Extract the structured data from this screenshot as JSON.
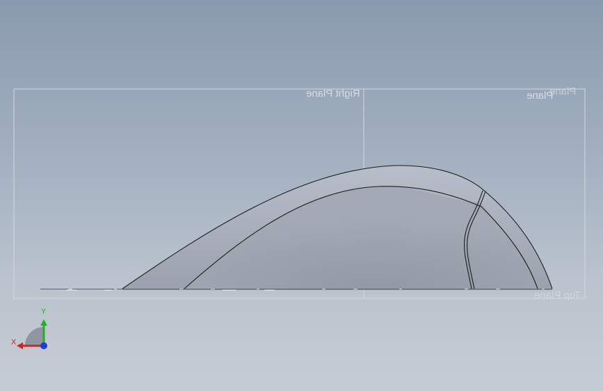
{
  "view": {
    "name": "cad-graphics-area",
    "background_top": "#8a9aae",
    "background_bottom": "#c6ccd4"
  },
  "planes": {
    "right_label": "Right Plane",
    "front_label": "Plane",
    "front_label_overlap": "Plane",
    "top_label": "Top Plane"
  },
  "triad": {
    "x_label": "X",
    "y_label": "Y",
    "x_color": "#c42a2a",
    "y_color": "#22b022",
    "z_color": "#1d3fd6"
  },
  "model": {
    "description_icon": "revolved-surface-part",
    "edge_color": "#1a1a1a",
    "face_color": "#a2aab6"
  }
}
